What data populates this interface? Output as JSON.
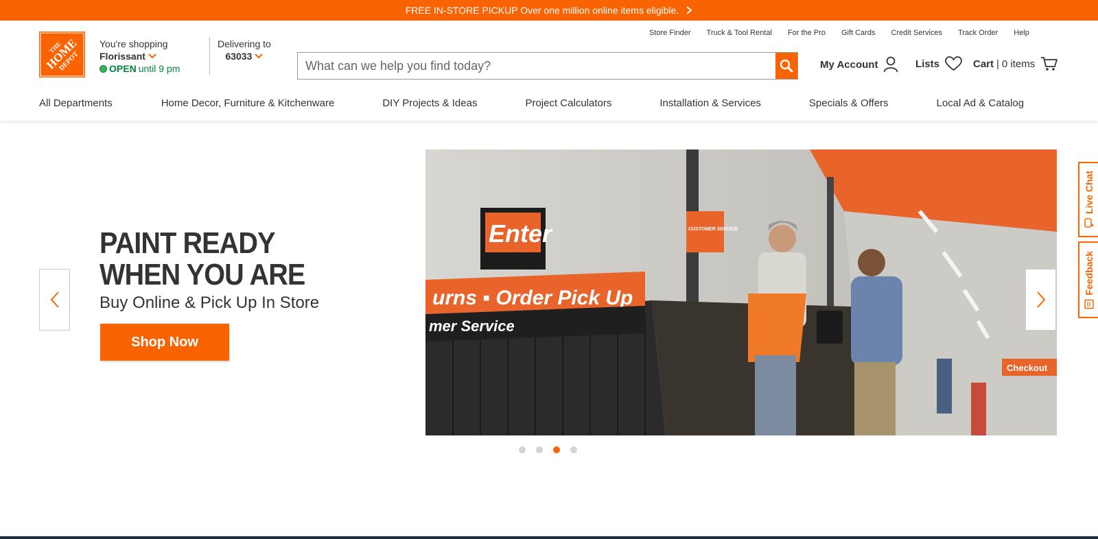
{
  "promo": {
    "text": "FREE IN-STORE PICKUP Over one million online items eligible."
  },
  "brand": {
    "color": "#f96302",
    "logo_lines": [
      "THE",
      "HOME",
      "DEPOT"
    ]
  },
  "store": {
    "label": "You're shopping",
    "name": "Florissant",
    "status": "OPEN",
    "hours": "until 9 pm"
  },
  "delivery": {
    "label": "Delivering to",
    "zip": "63033"
  },
  "utility_links": [
    "Store Finder",
    "Truck & Tool Rental",
    "For the Pro",
    "Gift Cards",
    "Credit Services",
    "Track Order",
    "Help"
  ],
  "search": {
    "placeholder": "What can we help you find today?"
  },
  "account": {
    "label": "My Account"
  },
  "lists": {
    "label": "Lists"
  },
  "cart": {
    "label": "Cart",
    "separator": "|",
    "count": "0 items"
  },
  "nav": [
    "All Departments",
    "Home Decor, Furniture & Kitchenware",
    "DIY Projects & Ideas",
    "Project Calculators",
    "Installation & Services",
    "Specials & Offers",
    "Local Ad & Catalog"
  ],
  "hero": {
    "title_line1": "PAINT READY",
    "title_line2": "WHEN YOU ARE",
    "subtitle": "Buy Online & Pick Up In Store",
    "cta": "Shop Now",
    "image_signs": {
      "enter": "Enter",
      "banner": "urns ▪ Order Pick Up",
      "service": "mer Service",
      "customer_service": "CUSTOMER SERVICE",
      "checkout": "Checkout"
    }
  },
  "carousel": {
    "slides": 4,
    "active_index": 2
  },
  "side_tabs": {
    "chat": "Live Chat",
    "feedback": "Feedback"
  }
}
